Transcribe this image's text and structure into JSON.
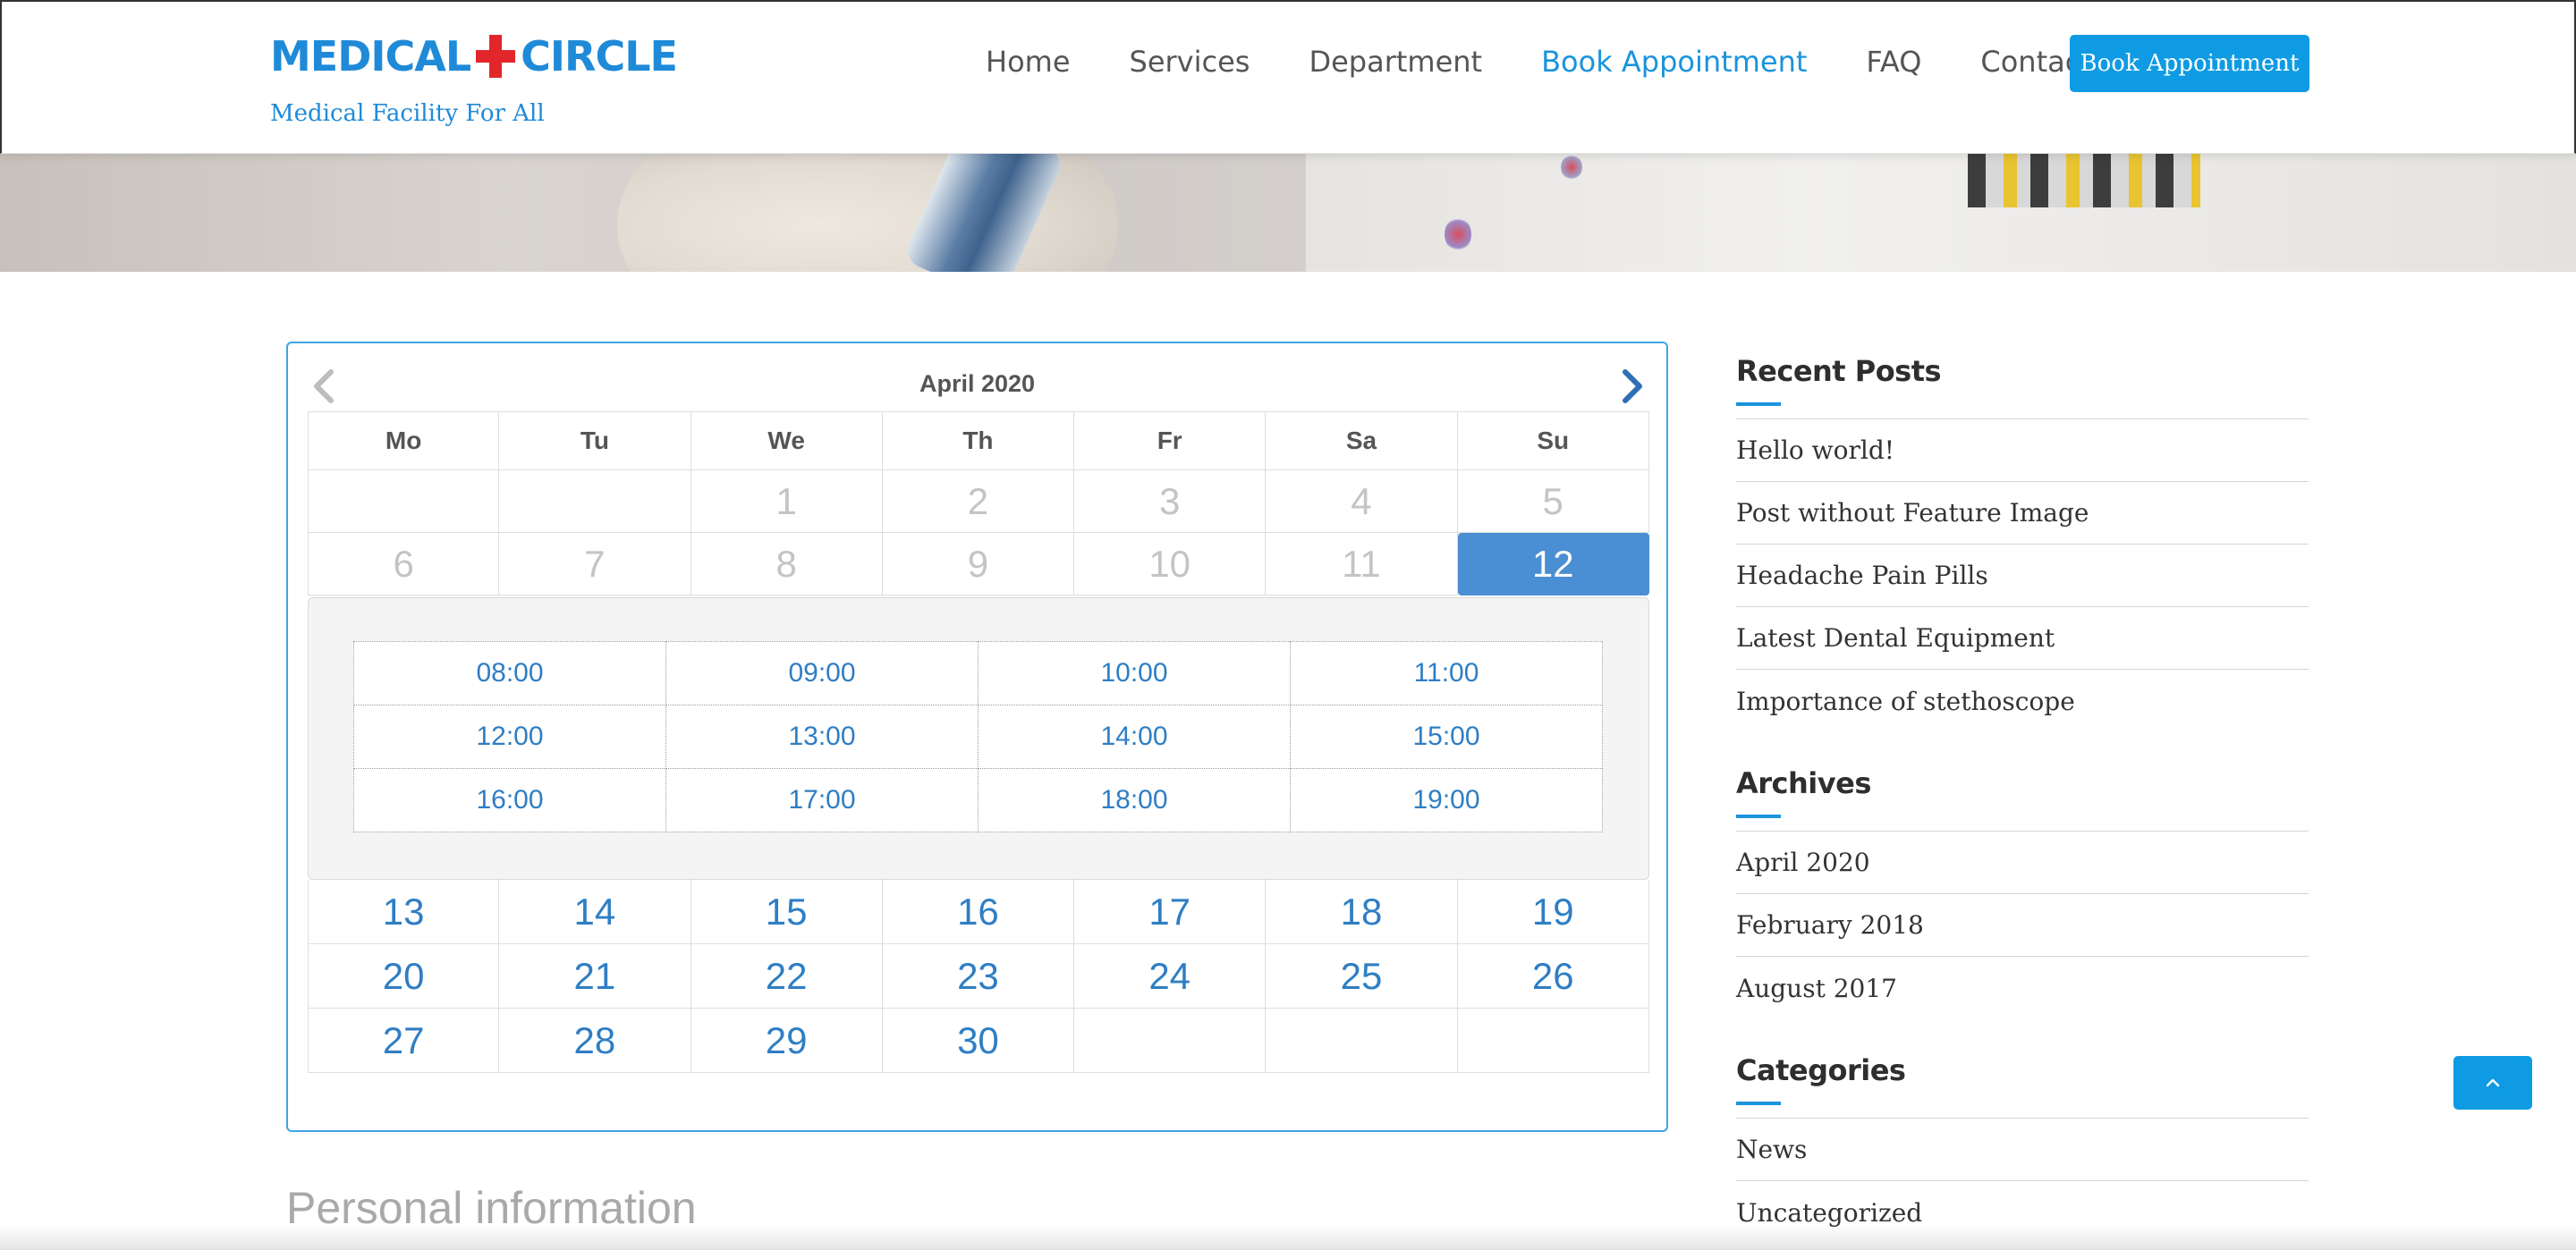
{
  "brand": {
    "name_left": "MEDICAL",
    "name_right": "CIRCLE",
    "tagline": "Medical Facility For All",
    "accent": "#1a94dc",
    "cross_color": "#e3262b"
  },
  "nav": {
    "items": [
      {
        "label": "Home",
        "active": false
      },
      {
        "label": "Services",
        "active": false
      },
      {
        "label": "Department",
        "active": false
      },
      {
        "label": "Book Appointment",
        "active": true
      },
      {
        "label": "FAQ",
        "active": false
      },
      {
        "label": "Contact",
        "active": false
      }
    ],
    "cta_label": "Book Appointment"
  },
  "calendar": {
    "title": "April 2020",
    "weekdays": [
      "Mo",
      "Tu",
      "We",
      "Th",
      "Fr",
      "Sa",
      "Su"
    ],
    "week1": [
      "",
      "",
      "1",
      "2",
      "3",
      "4",
      "5"
    ],
    "week2": [
      "6",
      "7",
      "8",
      "9",
      "10",
      "11",
      "12"
    ],
    "selected_day": "12",
    "time_slots": [
      [
        "08:00",
        "09:00",
        "10:00",
        "11:00"
      ],
      [
        "12:00",
        "13:00",
        "14:00",
        "15:00"
      ],
      [
        "16:00",
        "17:00",
        "18:00",
        "19:00"
      ]
    ],
    "week3": [
      "13",
      "14",
      "15",
      "16",
      "17",
      "18",
      "19"
    ],
    "week4": [
      "20",
      "21",
      "22",
      "23",
      "24",
      "25",
      "26"
    ],
    "week5": [
      "27",
      "28",
      "29",
      "30",
      "",
      "",
      ""
    ]
  },
  "personal_heading": "Personal information",
  "sidebar": {
    "recent_posts": {
      "title": "Recent Posts",
      "items": [
        "Hello world!",
        "Post without Feature Image",
        "Headache Pain Pills",
        "Latest Dental Equipment",
        "Importance of stethoscope"
      ]
    },
    "archives": {
      "title": "Archives",
      "items": [
        "April 2020",
        "February 2018",
        "August 2017"
      ]
    },
    "categories": {
      "title": "Categories",
      "items": [
        "News",
        "Uncategorized"
      ]
    }
  },
  "icons": {
    "prev": "chevron-left-icon",
    "next": "chevron-right-icon",
    "scroll_top": "chevron-up-icon"
  }
}
